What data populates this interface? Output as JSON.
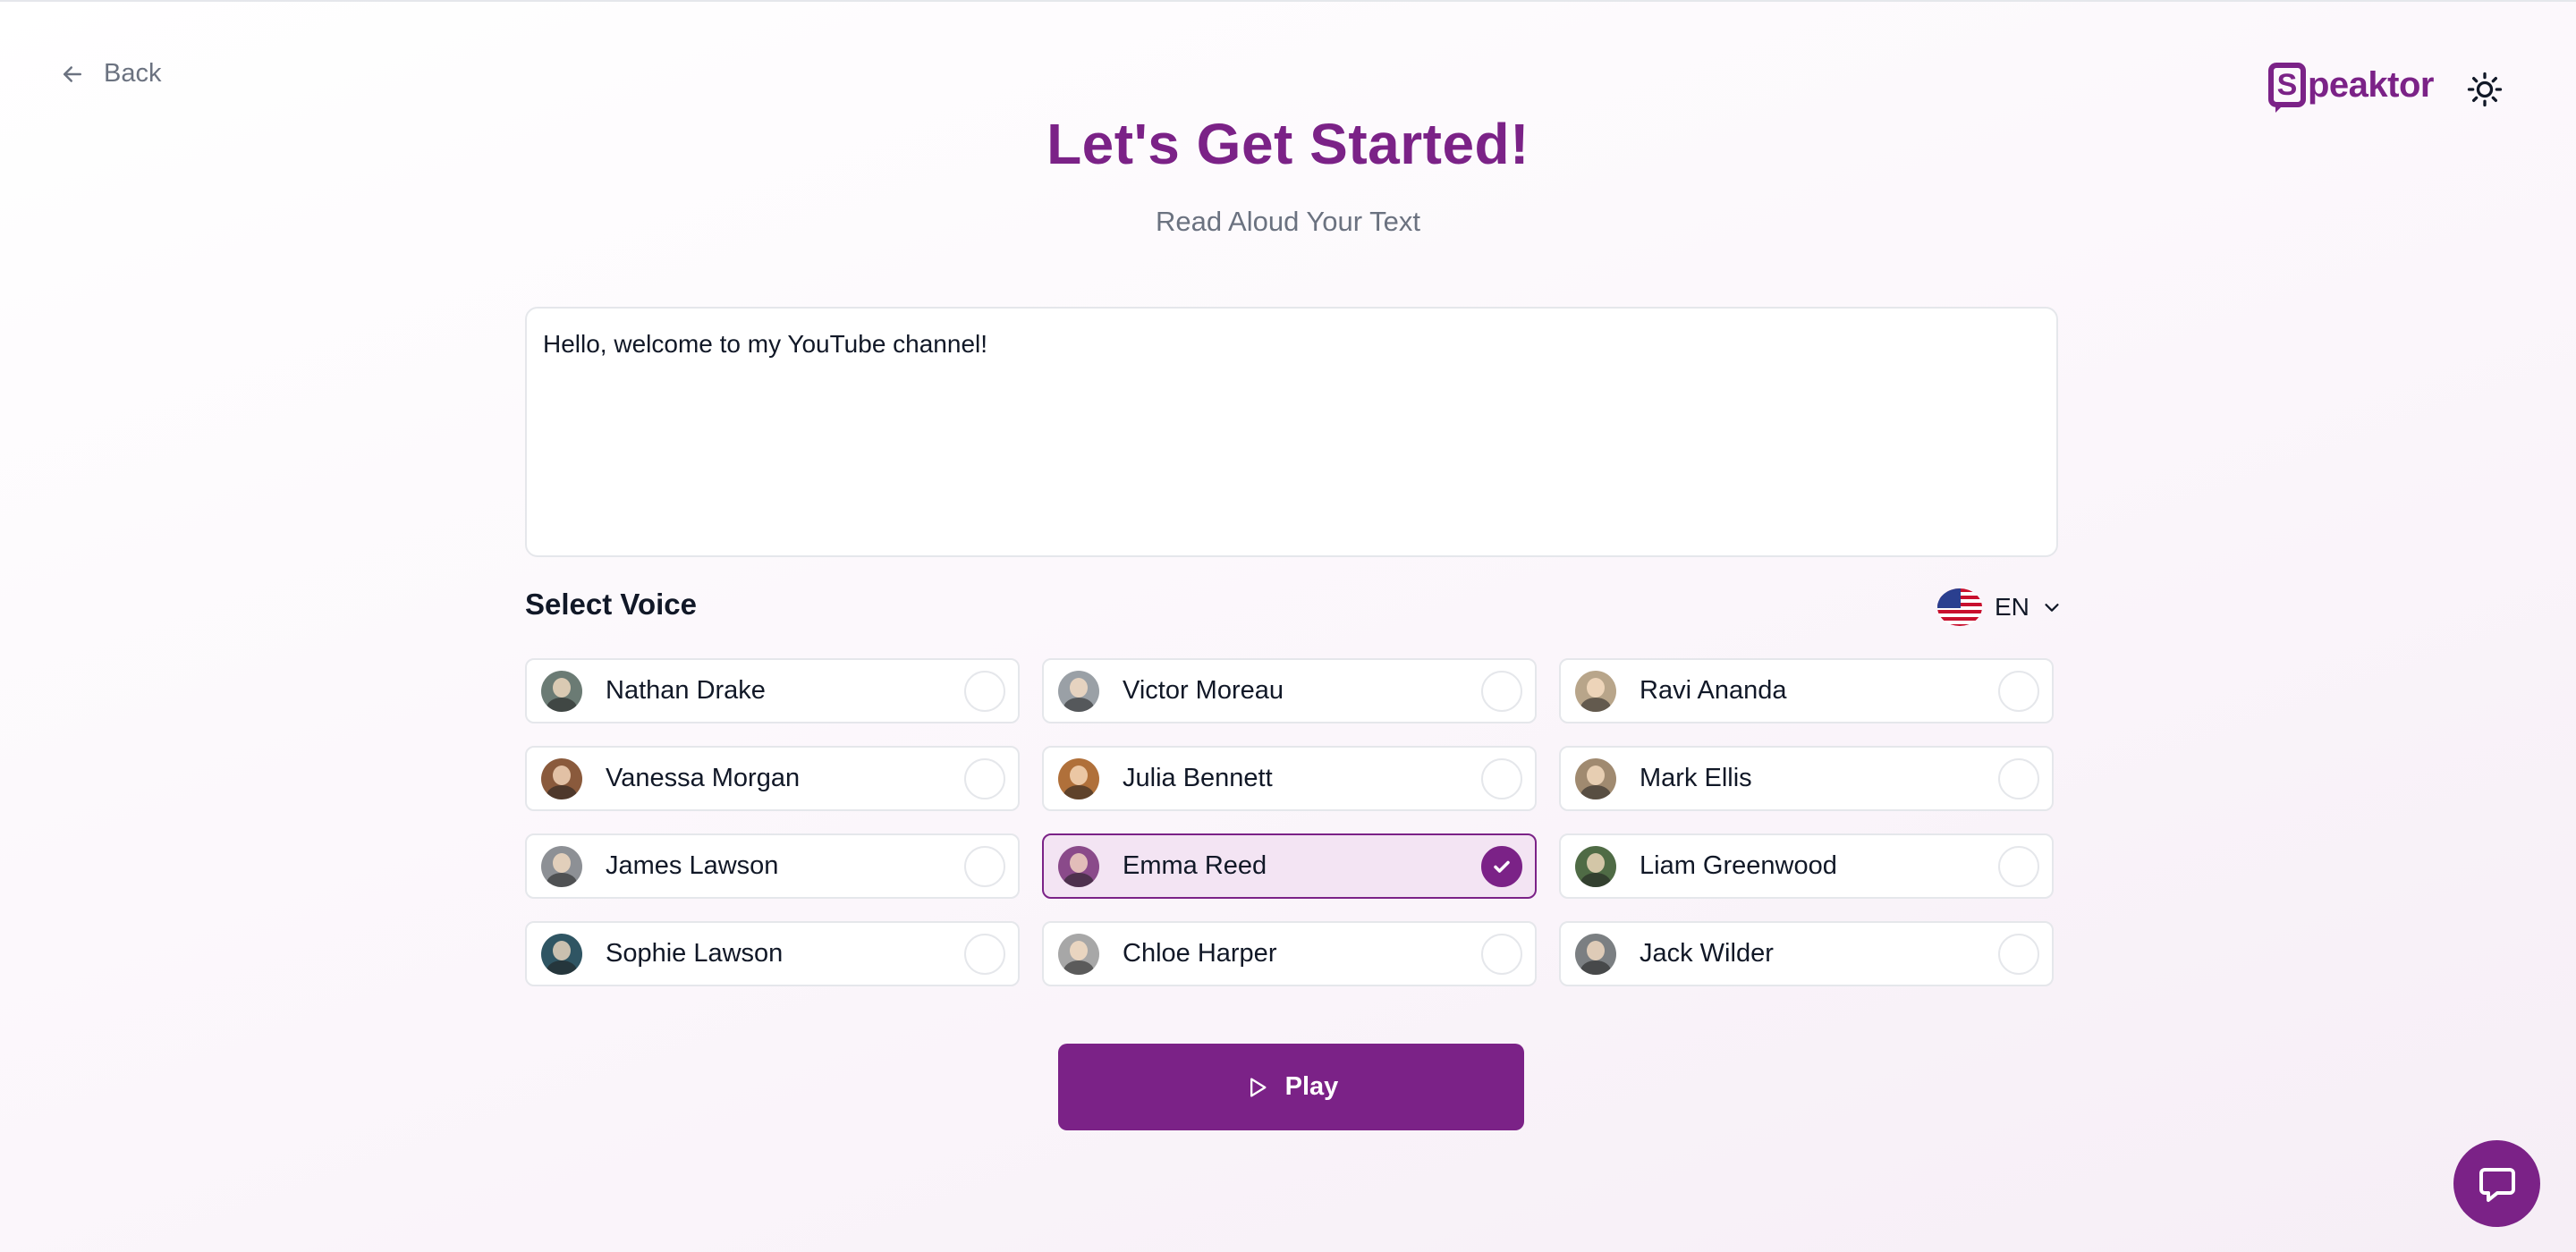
{
  "nav": {
    "back_label": "Back",
    "back_icon": "arrow-left-icon"
  },
  "brand": {
    "logo_letter": "S",
    "logo_rest": "peaktor"
  },
  "theme_toggle": {
    "icon": "sun-icon"
  },
  "header": {
    "title": "Let's Get Started!",
    "subtitle": "Read Aloud Your Text"
  },
  "text_input": {
    "value": "Hello, welcome to my YouTube channel!"
  },
  "voice_section": {
    "label": "Select Voice",
    "language": {
      "code": "EN",
      "flag": "us-flag-icon"
    },
    "voices": [
      {
        "name": "Nathan Drake",
        "selected": false,
        "avatar_color": "#6b7b74"
      },
      {
        "name": "Victor Moreau",
        "selected": false,
        "avatar_color": "#9aa0a6"
      },
      {
        "name": "Ravi Ananda",
        "selected": false,
        "avatar_color": "#b8a58a"
      },
      {
        "name": "Vanessa Morgan",
        "selected": false,
        "avatar_color": "#8a5a3c"
      },
      {
        "name": "Julia Bennett",
        "selected": false,
        "avatar_color": "#b0703a"
      },
      {
        "name": "Mark Ellis",
        "selected": false,
        "avatar_color": "#a08a70"
      },
      {
        "name": "James Lawson",
        "selected": false,
        "avatar_color": "#8d9095"
      },
      {
        "name": "Emma Reed",
        "selected": true,
        "avatar_color": "#8a4a8a"
      },
      {
        "name": "Liam Greenwood",
        "selected": false,
        "avatar_color": "#4f6b45"
      },
      {
        "name": "Sophie Lawson",
        "selected": false,
        "avatar_color": "#2f5563"
      },
      {
        "name": "Chloe Harper",
        "selected": false,
        "avatar_color": "#a7a7a7"
      },
      {
        "name": "Jack Wilder",
        "selected": false,
        "avatar_color": "#7b7f82"
      }
    ]
  },
  "play_button": {
    "label": "Play",
    "icon": "play-icon"
  },
  "chat_widget": {
    "icon": "chat-icon"
  },
  "colors": {
    "brand": "#7b2287",
    "selected_bg": "#f3e4f3",
    "muted_text": "#6b7280"
  }
}
